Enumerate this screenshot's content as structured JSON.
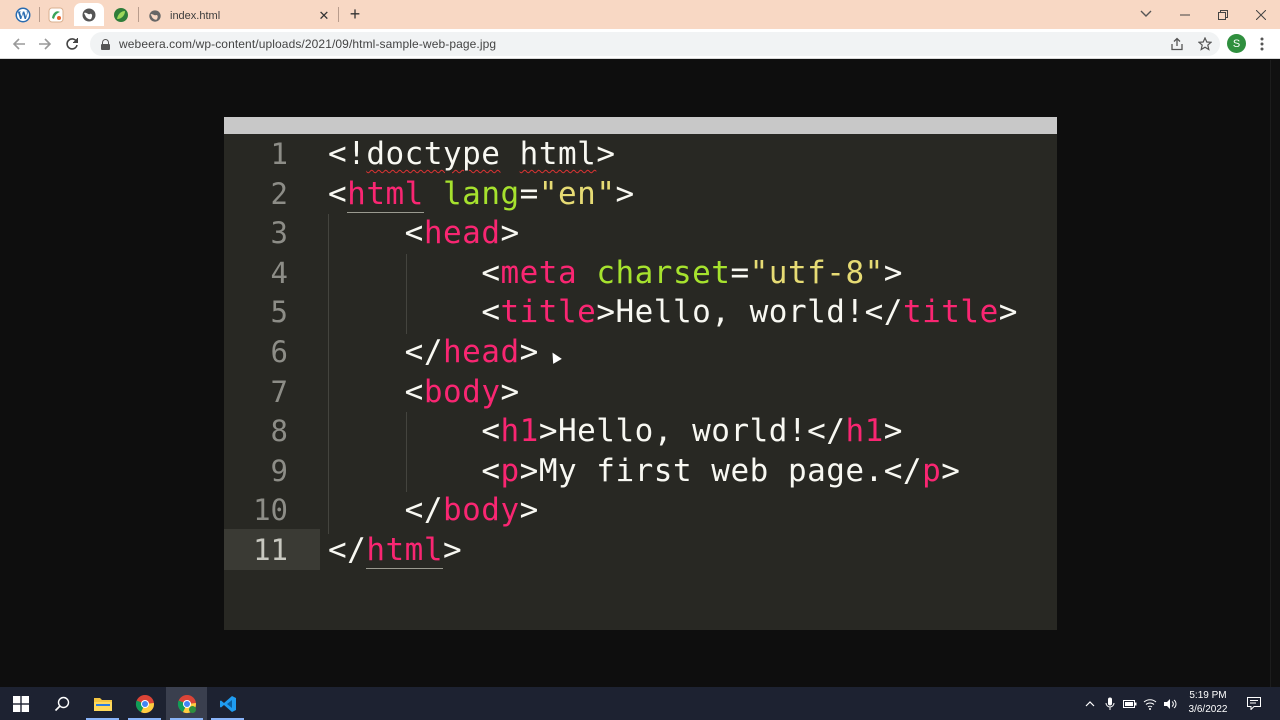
{
  "browser": {
    "tabs": [
      {
        "icon": "wordpress-icon",
        "active": false
      },
      {
        "icon": "site-favicon-icon",
        "active": false
      },
      {
        "icon": "globe-icon",
        "active": true
      },
      {
        "icon": "leaf-favicon-icon",
        "active": false
      },
      {
        "icon": "globe-icon",
        "title": "index.html",
        "active": false
      }
    ],
    "close_glyph": "✕",
    "new_tab_glyph": "+",
    "url": "webeera.com/wp-content/uploads/2021/09/html-sample-web-page.jpg",
    "profile_initial": "S",
    "colors": {
      "tabstrip": "#f8d8c4",
      "profile": "#2f8f3e"
    }
  },
  "editor": {
    "line_numbers": [
      "1",
      "2",
      "3",
      "4",
      "5",
      "6",
      "7",
      "8",
      "9",
      "10",
      "11"
    ],
    "current_line": "11",
    "code_lines": [
      {
        "indent": "",
        "tokens": [
          [
            "pl",
            "<!"
          ],
          [
            "sq",
            "doctype"
          ],
          [
            "pl",
            " "
          ],
          [
            "sq",
            "html"
          ],
          [
            "pl",
            ">"
          ]
        ]
      },
      {
        "indent": "",
        "tokens": [
          [
            "pl",
            "<"
          ],
          [
            "tagu",
            "html"
          ],
          [
            "pl",
            " "
          ],
          [
            "attr",
            "lang"
          ],
          [
            "pl",
            "="
          ],
          [
            "str",
            "\"en\""
          ],
          [
            "pl",
            ">"
          ]
        ]
      },
      {
        "indent": "    ",
        "tokens": [
          [
            "pl",
            "<"
          ],
          [
            "tag",
            "head"
          ],
          [
            "pl",
            ">"
          ]
        ]
      },
      {
        "indent": "        ",
        "tokens": [
          [
            "pl",
            "<"
          ],
          [
            "tag",
            "meta"
          ],
          [
            "pl",
            " "
          ],
          [
            "attr",
            "charset"
          ],
          [
            "pl",
            "="
          ],
          [
            "str",
            "\"utf-8\""
          ],
          [
            "pl",
            ">"
          ]
        ]
      },
      {
        "indent": "        ",
        "tokens": [
          [
            "pl",
            "<"
          ],
          [
            "tag",
            "title"
          ],
          [
            "pl",
            ">Hello, world!</"
          ],
          [
            "tag",
            "title"
          ],
          [
            "pl",
            ">"
          ]
        ]
      },
      {
        "indent": "    ",
        "tokens": [
          [
            "pl",
            "</"
          ],
          [
            "tag",
            "head"
          ],
          [
            "pl",
            ">"
          ]
        ]
      },
      {
        "indent": "    ",
        "tokens": [
          [
            "pl",
            "<"
          ],
          [
            "tag",
            "body"
          ],
          [
            "pl",
            ">"
          ]
        ]
      },
      {
        "indent": "        ",
        "tokens": [
          [
            "pl",
            "<"
          ],
          [
            "tag",
            "h1"
          ],
          [
            "pl",
            ">Hello, world!</"
          ],
          [
            "tag",
            "h1"
          ],
          [
            "pl",
            ">"
          ]
        ]
      },
      {
        "indent": "        ",
        "tokens": [
          [
            "pl",
            "<"
          ],
          [
            "tag",
            "p"
          ],
          [
            "pl",
            ">My first web page.</"
          ],
          [
            "tag",
            "p"
          ],
          [
            "pl",
            ">"
          ]
        ]
      },
      {
        "indent": "    ",
        "tokens": [
          [
            "pl",
            "</"
          ],
          [
            "tag",
            "body"
          ],
          [
            "pl",
            ">"
          ]
        ]
      },
      {
        "indent": "",
        "tokens": [
          [
            "pl",
            "</"
          ],
          [
            "tagu",
            "html"
          ],
          [
            "pl",
            ">"
          ]
        ]
      }
    ],
    "colors": {
      "background": "#282823",
      "tag": "#f92672",
      "attribute": "#a6e22e",
      "string": "#e6db74",
      "plain": "#f8f8f2"
    }
  },
  "taskbar": {
    "apps": [
      {
        "name": "start-button",
        "icon": "windows-logo-icon"
      },
      {
        "name": "search-button",
        "icon": "search-icon"
      },
      {
        "name": "file-explorer-button",
        "icon": "folder-icon"
      },
      {
        "name": "chrome-button",
        "icon": "chrome-icon"
      },
      {
        "name": "chrome-profile-button",
        "icon": "chrome-icon",
        "active": true
      },
      {
        "name": "vscode-button",
        "icon": "vscode-icon"
      }
    ],
    "time": "5:19 PM",
    "date": "3/6/2022"
  }
}
